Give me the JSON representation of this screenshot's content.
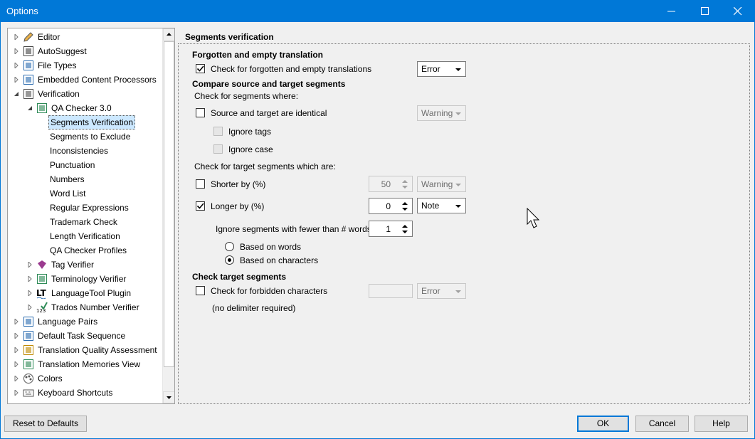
{
  "window": {
    "title": "Options"
  },
  "tree": {
    "items": [
      {
        "label": "Editor",
        "level": 0,
        "expander": "collapsed",
        "icon": "editor-icon"
      },
      {
        "label": "AutoSuggest",
        "level": 0,
        "expander": "collapsed",
        "icon": "autosuggest-icon"
      },
      {
        "label": "File Types",
        "level": 0,
        "expander": "collapsed",
        "icon": "file-types-icon"
      },
      {
        "label": "Embedded Content Processors",
        "level": 0,
        "expander": "collapsed",
        "icon": "embedded-content-icon"
      },
      {
        "label": "Verification",
        "level": 0,
        "expander": "expanded",
        "icon": "verification-icon"
      },
      {
        "label": "QA Checker 3.0",
        "level": 1,
        "expander": "expanded",
        "icon": "qa-checker-icon"
      },
      {
        "label": "Segments Verification",
        "level": 2,
        "selected": true
      },
      {
        "label": "Segments to Exclude",
        "level": 2
      },
      {
        "label": "Inconsistencies",
        "level": 2
      },
      {
        "label": "Punctuation",
        "level": 2
      },
      {
        "label": "Numbers",
        "level": 2
      },
      {
        "label": "Word List",
        "level": 2
      },
      {
        "label": "Regular Expressions",
        "level": 2
      },
      {
        "label": "Trademark Check",
        "level": 2
      },
      {
        "label": "Length Verification",
        "level": 2
      },
      {
        "label": "QA Checker Profiles",
        "level": 2
      },
      {
        "label": "Tag Verifier",
        "level": 1,
        "expander": "collapsed",
        "icon": "tag-verifier-icon"
      },
      {
        "label": "Terminology Verifier",
        "level": 1,
        "expander": "collapsed",
        "icon": "terminology-verifier-icon"
      },
      {
        "label": "LanguageTool Plugin",
        "level": 1,
        "expander": "collapsed",
        "icon": "languagetool-icon"
      },
      {
        "label": "Trados Number Verifier",
        "level": 1,
        "expander": "collapsed",
        "icon": "number-verifier-icon"
      },
      {
        "label": "Language Pairs",
        "level": 0,
        "expander": "collapsed",
        "icon": "language-pairs-icon"
      },
      {
        "label": "Default Task Sequence",
        "level": 0,
        "expander": "collapsed",
        "icon": "task-sequence-icon"
      },
      {
        "label": "Translation Quality Assessment",
        "level": 0,
        "expander": "collapsed",
        "icon": "tqa-icon"
      },
      {
        "label": "Translation Memories View",
        "level": 0,
        "expander": "collapsed",
        "icon": "tm-view-icon"
      },
      {
        "label": "Colors",
        "level": 0,
        "expander": "collapsed",
        "icon": "colors-icon"
      },
      {
        "label": "Keyboard Shortcuts",
        "level": 0,
        "expander": "collapsed",
        "icon": "keyboard-icon"
      }
    ]
  },
  "panel": {
    "title": "Segments verification",
    "forgotten": {
      "heading": "Forgotten and empty translation",
      "check_label": "Check for forgotten and empty translations",
      "checked": true,
      "severity": "Error"
    },
    "compare": {
      "heading": "Compare source and target segments",
      "intro": "Check for segments where:",
      "identical_label": "Source and target are identical",
      "identical_checked": false,
      "identical_severity": "Warning",
      "ignore_tags_label": "Ignore tags",
      "ignore_case_label": "Ignore case",
      "target_intro": "Check for target segments which are:",
      "shorter_label": "Shorter by (%)",
      "shorter_checked": false,
      "shorter_value": "50",
      "shorter_severity": "Warning",
      "longer_label": "Longer by (%)",
      "longer_checked": true,
      "longer_value": "0",
      "longer_severity": "Note",
      "ignore_words_label": "Ignore segments with fewer than # words:",
      "ignore_words_value": "1",
      "based_words_label": "Based on words",
      "based_chars_label": "Based on characters",
      "based_selected": "characters"
    },
    "target": {
      "heading": "Check target segments",
      "forbidden_label": "Check for forbidden characters",
      "forbidden_checked": false,
      "forbidden_value": "",
      "forbidden_severity": "Error",
      "delimiter_note": "(no delimiter required)"
    }
  },
  "buttons": {
    "reset": "Reset to Defaults",
    "ok": "OK",
    "cancel": "Cancel",
    "help": "Help"
  }
}
